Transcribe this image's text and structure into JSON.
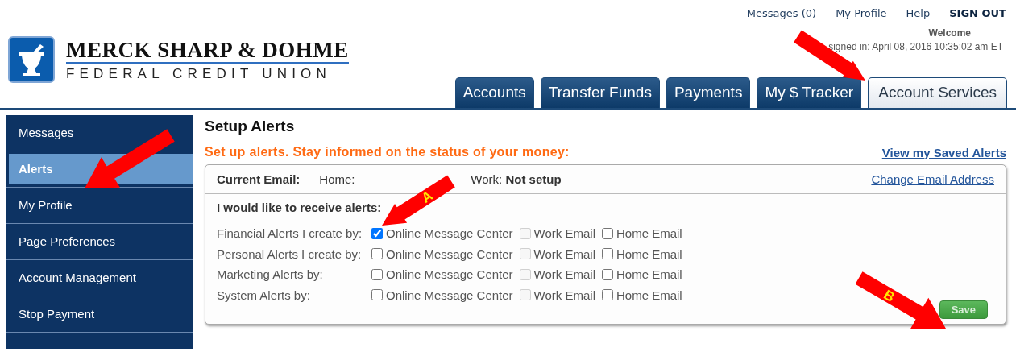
{
  "top_links": [
    {
      "label": "Messages (0)",
      "bold": false
    },
    {
      "label": "My Profile",
      "bold": false
    },
    {
      "label": "Help",
      "bold": false
    },
    {
      "label": "SIGN OUT",
      "bold": true
    }
  ],
  "logo": {
    "name": "MERCK SHARP & DOHME",
    "subtitle": "FEDERAL CREDIT UNION"
  },
  "welcome": {
    "title": "Welcome",
    "signed_in": "signed in: April 08, 2016 10:35:02 am ET"
  },
  "tabs": [
    {
      "label": "Accounts",
      "selected": false
    },
    {
      "label": "Transfer Funds",
      "selected": false
    },
    {
      "label": "Payments",
      "selected": false
    },
    {
      "label": "My $ Tracker",
      "selected": false
    },
    {
      "label": "Account Services",
      "selected": true
    }
  ],
  "sidebar": {
    "items": [
      {
        "label": "Messages",
        "selected": false
      },
      {
        "label": "Alerts",
        "selected": true
      },
      {
        "label": "My Profile",
        "selected": false
      },
      {
        "label": "Page Preferences",
        "selected": false
      },
      {
        "label": "Account Management",
        "selected": false
      },
      {
        "label": "Stop Payment",
        "selected": false
      }
    ]
  },
  "page_title": "Setup Alerts",
  "intro": "Set up alerts. Stay informed on the status of your money:",
  "saved_alerts_link": "View my  Saved Alerts",
  "email": {
    "label": "Current Email:",
    "home_label": "Home:",
    "work_label": "Work:",
    "work_value": "Not setup",
    "change_link": "Change Email Address"
  },
  "alerts": {
    "heading": "I would like to receive alerts:",
    "rows": [
      {
        "label": "Financial Alerts I create by:",
        "options": [
          {
            "label": "Online Message Center",
            "checked": true,
            "disabled": false
          },
          {
            "label": "Work Email",
            "checked": false,
            "disabled": true
          },
          {
            "label": "Home Email",
            "checked": false,
            "disabled": false
          }
        ]
      },
      {
        "label": "Personal Alerts I create by:",
        "options": [
          {
            "label": "Online Message Center",
            "checked": false,
            "disabled": false
          },
          {
            "label": "Work Email",
            "checked": false,
            "disabled": true
          },
          {
            "label": "Home Email",
            "checked": false,
            "disabled": false
          }
        ]
      },
      {
        "label": "Marketing Alerts by:",
        "options": [
          {
            "label": "Online Message Center",
            "checked": false,
            "disabled": false
          },
          {
            "label": "Work Email",
            "checked": false,
            "disabled": true
          },
          {
            "label": "Home Email",
            "checked": false,
            "disabled": false
          }
        ]
      },
      {
        "label": "System Alerts by:",
        "options": [
          {
            "label": "Online Message Center",
            "checked": false,
            "disabled": false
          },
          {
            "label": "Work Email",
            "checked": false,
            "disabled": true
          },
          {
            "label": "Home Email",
            "checked": false,
            "disabled": false
          }
        ]
      }
    ]
  },
  "save_button": "Save",
  "annotations": [
    {
      "label": "A"
    },
    {
      "label": "B"
    }
  ]
}
